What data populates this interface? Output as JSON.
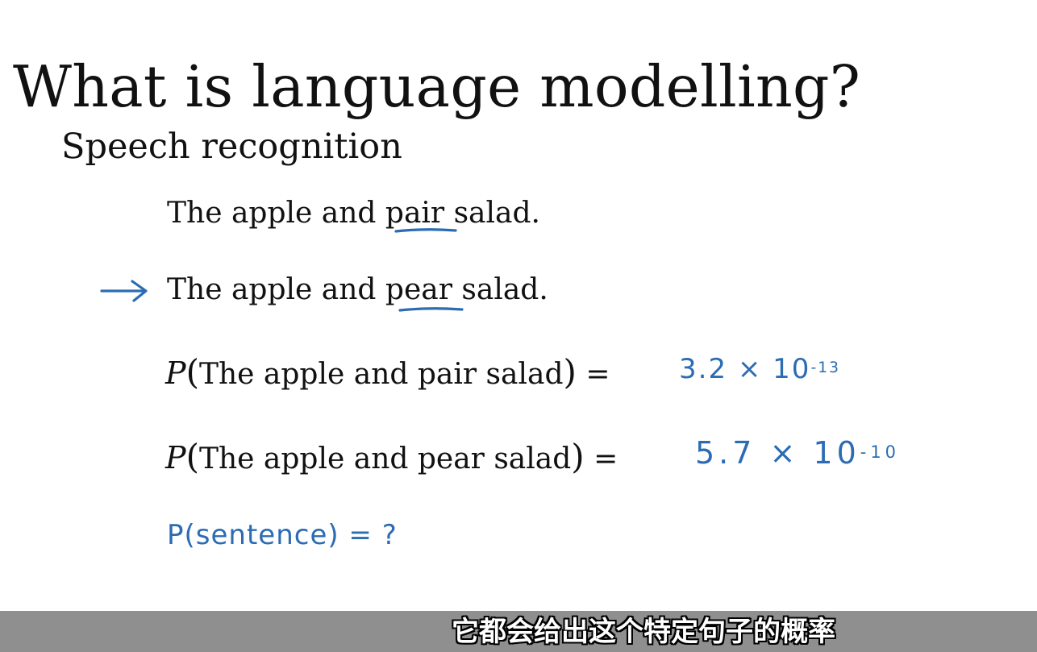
{
  "slide": {
    "title": "What is language modelling?",
    "subtitle": "Speech recognition",
    "sentence1": {
      "pre": "The apple and ",
      "underlined": "pair",
      "post": " salad."
    },
    "sentence2": {
      "pre": "The apple and ",
      "underlined": "pear",
      "post": " salad."
    },
    "prob1": {
      "symbol": "P",
      "open": "(",
      "arg": "The apple and pair salad",
      "close": ")",
      "equals": " ="
    },
    "prob2": {
      "symbol": "P",
      "open": "(",
      "arg": "The apple and pear salad",
      "close": ")",
      "equals": " ="
    }
  },
  "annotations": {
    "value1": {
      "mantissa": "3.2 × 10",
      "exponent": "-13"
    },
    "value2": {
      "mantissa": "5.7 × 10",
      "exponent": "-10"
    },
    "query": "P(sentence) = ?",
    "ink_color": "#2b6cb3"
  },
  "caption": "它都会给出这个特定句子的概率",
  "colors": {
    "caption_bar": "#8f8f8f",
    "text": "#111111",
    "background": "#ffffff"
  }
}
